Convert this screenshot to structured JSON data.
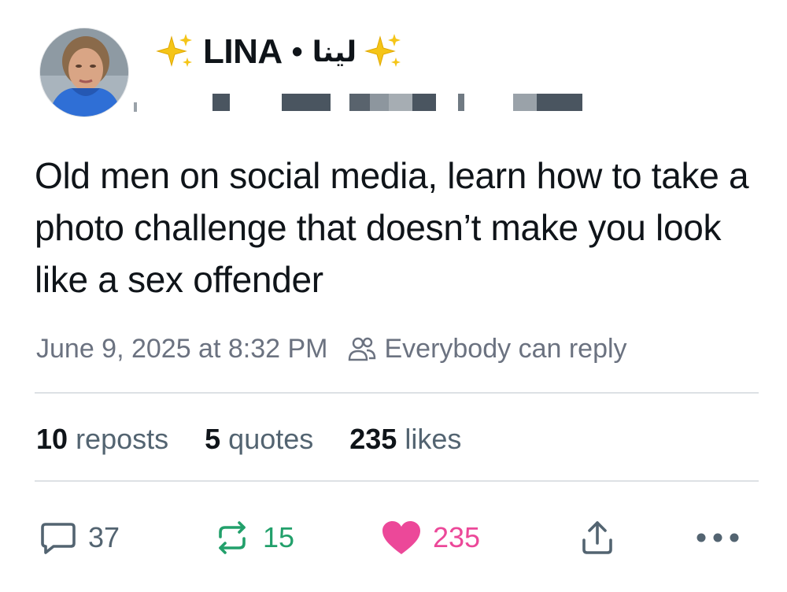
{
  "author": {
    "display_name": "LINA",
    "separator": "•",
    "arabic_name": "لينا",
    "sparkle_icon": "sparkles-icon",
    "avatar_icon": "profile-photo"
  },
  "post": {
    "text": "Old men on social media, learn how to take a photo challenge that doesn’t make you look like a sex offender"
  },
  "meta": {
    "timestamp": "June 9, 2025 at 8:32 PM",
    "reply_setting": "Everybody can reply",
    "reply_setting_icon": "people-icon"
  },
  "stats": {
    "reposts_count": "10",
    "reposts_label": "reposts",
    "quotes_count": "5",
    "quotes_label": "quotes",
    "likes_count": "235",
    "likes_label": "likes"
  },
  "actions": {
    "reply_count": "37",
    "repost_count": "15",
    "like_count": "235",
    "reply_icon": "reply-bubble-icon",
    "repost_icon": "repost-icon",
    "like_icon": "heart-icon",
    "share_icon": "share-icon",
    "more_icon": "more-icon"
  },
  "colors": {
    "text": "#0f1419",
    "muted": "#536471",
    "repost_green": "#22a06b",
    "like_pink": "#ec4899",
    "divider": "#dde1e5"
  }
}
